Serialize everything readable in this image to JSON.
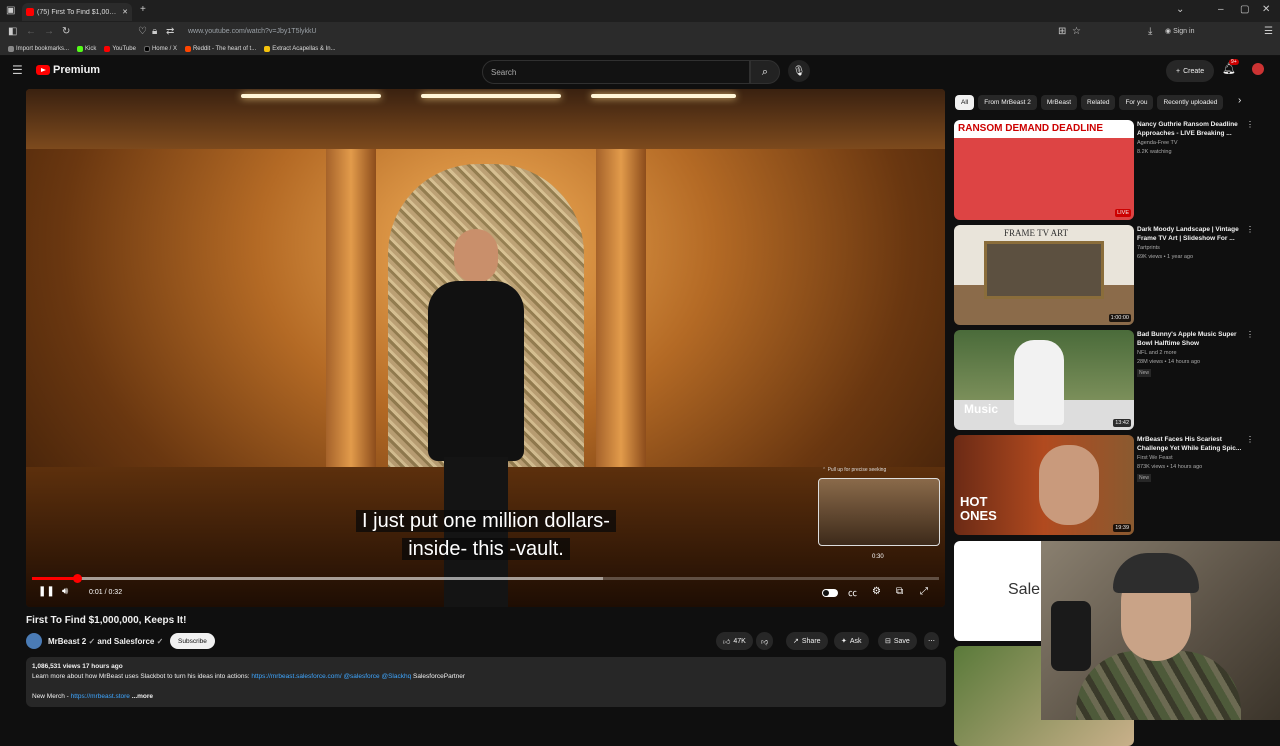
{
  "browser": {
    "tab_title": "(75) First To Find $1,000,000",
    "url": "www.youtube.com/watch?v=Jby1T5lykkU",
    "bookmarks": [
      "Import bookmarks...",
      "Kick",
      "YouTube",
      "Home / X",
      "Reddit - The heart of t...",
      "Extract Acapellas & In..."
    ],
    "sign_in": "Sign in"
  },
  "header": {
    "logo_text": "Premium",
    "search_placeholder": "Search",
    "create_label": "Create",
    "notif_count": "9+"
  },
  "player": {
    "caption_line1": "I just put one million dollars-",
    "caption_line2": "inside- this -vault.",
    "preview_hint": "Pull up for precise seeking",
    "preview_time": "0:30",
    "time": "0:01 / 0:32",
    "progress": 0.05,
    "buffered": 0.63
  },
  "video": {
    "title": "First To Find $1,000,000, Keeps It!",
    "channel": "MrBeast 2",
    "and_text": "and Salesforce",
    "subscribe": "Subscribe",
    "likes": "47K",
    "share": "Share",
    "ask": "Ask",
    "save": "Save",
    "meta": "1,086,531 views  17 hours ago",
    "desc_text": "Learn more about how MrBeast uses Slackbot to turn his ideas into actions:",
    "desc_link": "https://mrbeast.salesforce.com/",
    "desc_tags": "@salesforce @Slackhq",
    "desc_partner": "SalesforcePartner",
    "merch_label": "New Merch -",
    "merch_link": "https://mrbeast.store",
    "more": "...more"
  },
  "sidebar": {
    "chips": [
      "All",
      "From MrBeast 2",
      "MrBeast",
      "Related",
      "For you",
      "Recently uploaded"
    ],
    "recs": [
      {
        "title": "Nancy Guthrie Ransom Deadline Approaches - LIVE Breaking ...",
        "channel": "Agenda-Free TV",
        "meta": "8.2K watching",
        "badge": "LIVE",
        "thumb_text": "RANSOM DEMAND DEADLINE"
      },
      {
        "title": "Dark Moody Landscape | Vintage Frame TV Art | Slideshow For ...",
        "channel": "7artprints",
        "meta": "69K views • 1 year ago",
        "badge": "1:00:00",
        "thumb_text": "FRAME TV ART"
      },
      {
        "title": "Bad Bunny's Apple Music Super Bowl Halftime Show",
        "channel": "NFL and 2 more",
        "meta": "28M views • 14 hours ago",
        "new": "New",
        "badge": "13:42",
        "thumb_text": "Music"
      },
      {
        "title": "MrBeast Faces His Scariest Challenge Yet While Eating Spic...",
        "channel": "First We Feast",
        "meta": "873K views • 14 hours ago",
        "new": "New",
        "badge": "19:39",
        "thumb_text": "HOT ONES"
      },
      {
        "thumb_text": "Sale"
      }
    ]
  }
}
